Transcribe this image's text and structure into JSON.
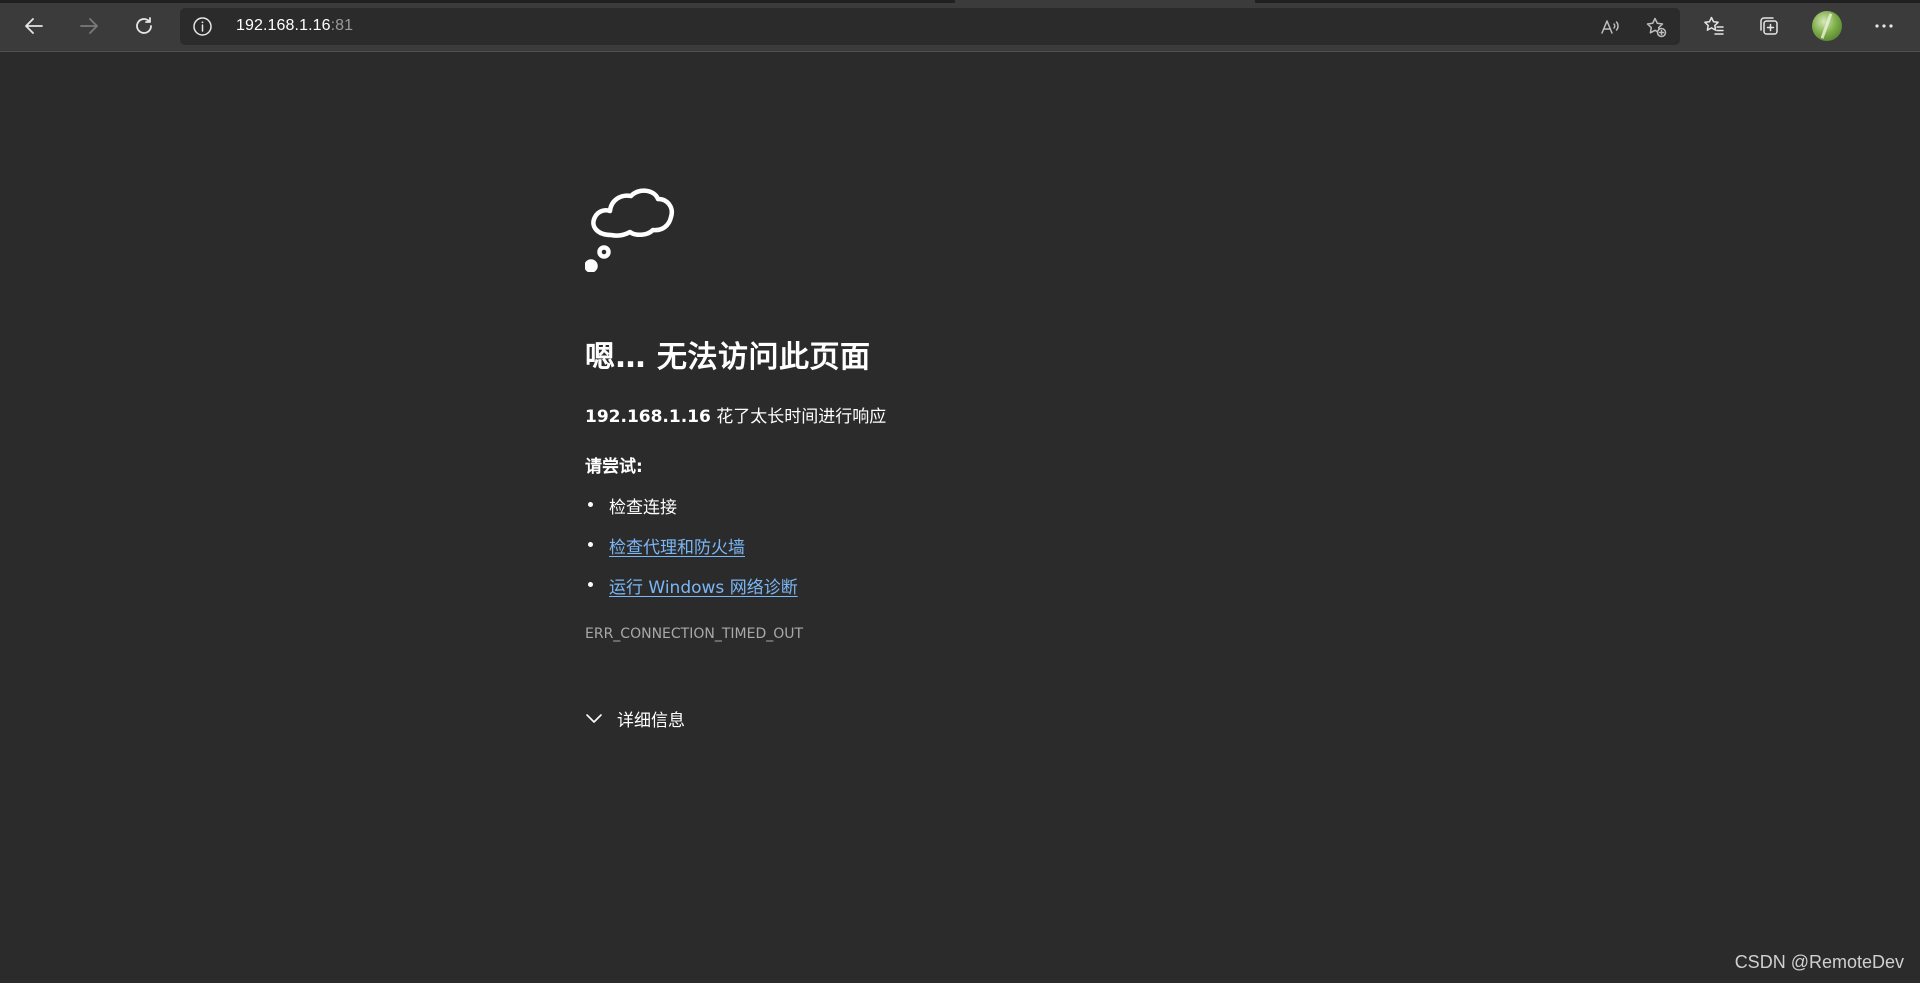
{
  "browser": {
    "address_bar": {
      "host": "192.168.1.16",
      "port": ":81"
    },
    "icons": {
      "back": "back-arrow-icon",
      "forward": "forward-arrow-icon",
      "refresh": "refresh-icon",
      "site_info": "info-icon",
      "read_aloud": "read-aloud-icon",
      "add_favorite": "add-favorite-icon",
      "favorites": "favorites-icon",
      "collections": "collections-icon",
      "profile": "avatar",
      "menu": "more-icon"
    }
  },
  "error_page": {
    "heading": "嗯… 无法访问此页面",
    "message_host": "192.168.1.16",
    "message_text": " 花了太长时间进行响应",
    "try_label": "请尝试:",
    "suggestions": [
      {
        "label": "检查连接",
        "is_link": false
      },
      {
        "label": "检查代理和防火墙",
        "is_link": true
      },
      {
        "label": "运行 Windows 网络诊断",
        "is_link": true
      }
    ],
    "error_code": "ERR_CONNECTION_TIMED_OUT",
    "details_label": "详细信息"
  },
  "watermark": "CSDN @RemoteDev",
  "colors": {
    "page_background": "#2b2b2b",
    "toolbar_background": "#3b3b3b",
    "link": "#7bb6f5",
    "muted_text": "#a8a8a8"
  }
}
